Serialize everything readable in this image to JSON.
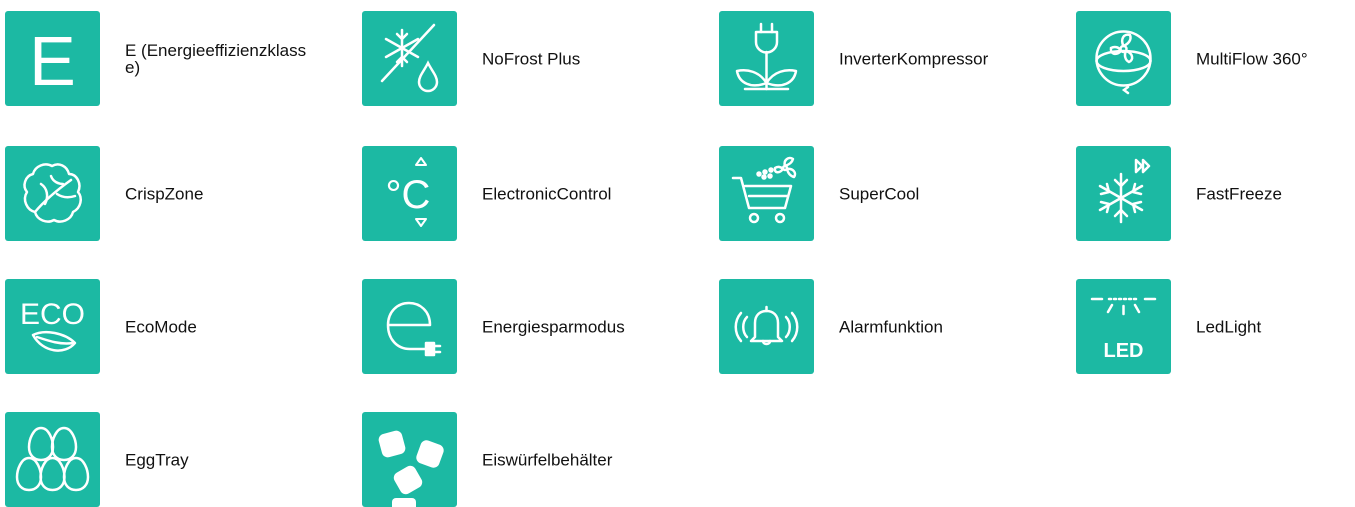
{
  "accent_color": "#1cb9a3",
  "features": [
    {
      "icon": "energy-class-e-icon",
      "label": "E (Energieeffizienzklasse)",
      "letter": "E"
    },
    {
      "icon": "nofrost-plus-icon",
      "label": "NoFrost Plus"
    },
    {
      "icon": "inverter-compressor-icon",
      "label": "InverterKompressor"
    },
    {
      "icon": "multiflow-360-icon",
      "label": "MultiFlow 360°"
    },
    {
      "icon": "crispzone-icon",
      "label": "CrispZone"
    },
    {
      "icon": "electronic-control-icon",
      "label": "ElectronicControl",
      "symbol": "°C"
    },
    {
      "icon": "supercool-icon",
      "label": "SuperCool"
    },
    {
      "icon": "fastfreeze-icon",
      "label": "FastFreeze"
    },
    {
      "icon": "ecomode-icon",
      "label": "EcoMode",
      "text": "ECO"
    },
    {
      "icon": "energy-saving-mode-icon",
      "label": "Energiesparmodus"
    },
    {
      "icon": "alarm-function-icon",
      "label": "Alarmfunktion"
    },
    {
      "icon": "led-light-icon",
      "label": "LedLight",
      "text": "LED"
    },
    {
      "icon": "egg-tray-icon",
      "label": "EggTray"
    },
    {
      "icon": "ice-cube-container-icon",
      "label": "Eiswürfelbehälter"
    }
  ]
}
